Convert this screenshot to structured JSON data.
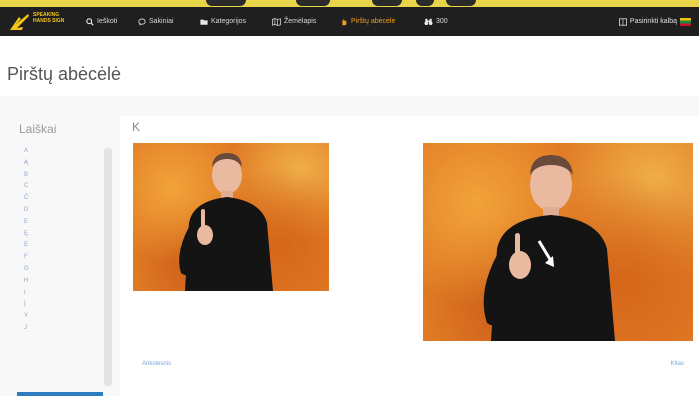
{
  "navbar": {
    "logo_text": "SPEAKING HANDS SIGN",
    "items": [
      {
        "label": "Ieškoti",
        "icon": "search-icon"
      },
      {
        "label": "Sakiniai",
        "icon": "chat-bubble-icon"
      },
      {
        "label": "Kategorijos",
        "icon": "folder-icon"
      },
      {
        "label": "Žemėlapis",
        "icon": "map-icon"
      },
      {
        "label": "Pirštų abėcėlė",
        "icon": "hand-icon"
      },
      {
        "label": "300",
        "icon": "binoculars-icon"
      }
    ],
    "language_label": "Pasirinkti kalbą",
    "colors": {
      "bar": "#1f1f1f",
      "active": "#f0a020",
      "strip": "#e9d54a"
    }
  },
  "page": {
    "title": "Pirštų abėcėlė"
  },
  "sidebar": {
    "title": "Laiškai",
    "letters": [
      "A",
      "Ą",
      "B",
      "C",
      "Č",
      "D",
      "E",
      "Ę",
      "Ė",
      "F",
      "G",
      "H",
      "I",
      "Į",
      "Y",
      "J"
    ],
    "selected_color": "#2d7cc0"
  },
  "main": {
    "current_letter": "K",
    "prev_label": "Ankstesnis",
    "next_label": "Kitas"
  }
}
